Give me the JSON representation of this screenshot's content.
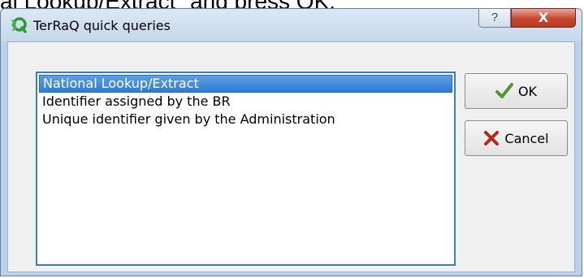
{
  "background_text": "al Lookup/Extract\" and press OK.",
  "window": {
    "title": "TerRaQ quick queries",
    "help_label": "?",
    "close_label": "X"
  },
  "query_list": {
    "items": [
      {
        "label": "National Lookup/Extract",
        "selected": true
      },
      {
        "label": "Identifier assigned by the BR",
        "selected": false
      },
      {
        "label": "Unique identifier given by the Administration",
        "selected": false
      }
    ]
  },
  "buttons": {
    "ok_label": "OK",
    "cancel_label": "Cancel"
  },
  "icons": {
    "app": "terraq-logo-icon",
    "ok": "checkmark-icon",
    "cancel": "x-cross-icon"
  },
  "colors": {
    "selection": "#3a86d8",
    "title_bar": "#c6d8ec",
    "close_button": "#c9462d"
  }
}
